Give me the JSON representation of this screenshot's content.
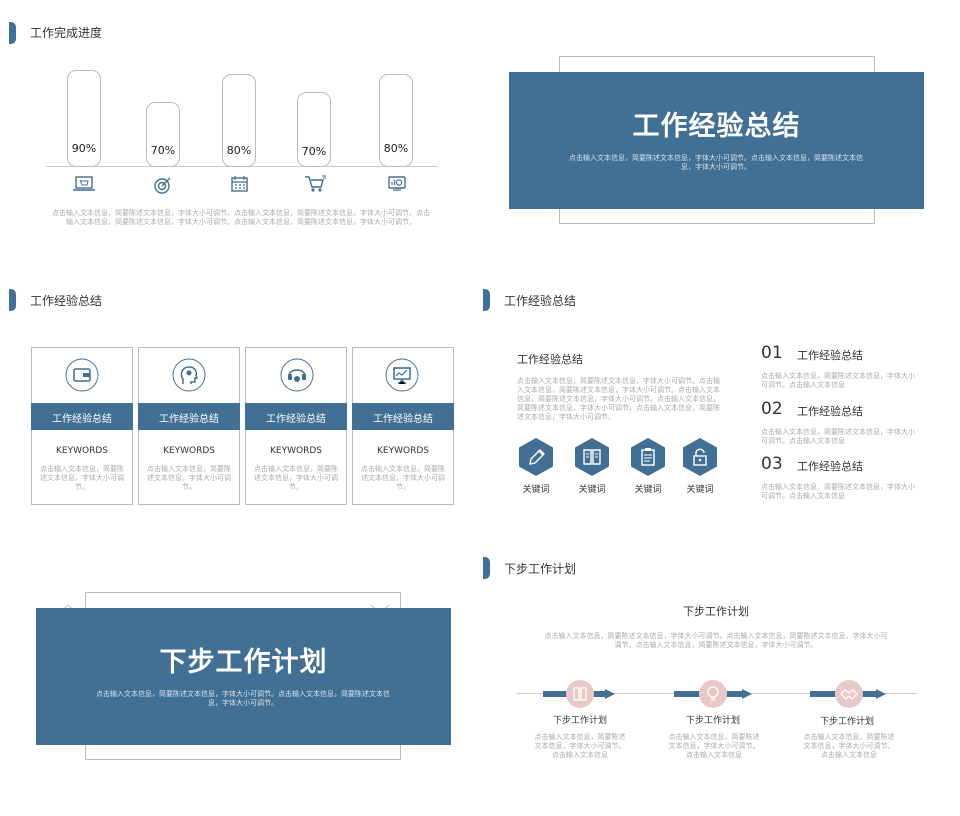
{
  "slide1": {
    "title": "工作完成进度",
    "bars": [
      {
        "label": "90%",
        "icon": "laptop-cart-icon"
      },
      {
        "label": "70%",
        "icon": "target-icon"
      },
      {
        "label": "80%",
        "icon": "calendar-icon"
      },
      {
        "label": "70%",
        "icon": "shopping-cart-icon"
      },
      {
        "label": "80%",
        "icon": "monitor-chart-icon"
      }
    ],
    "desc": "点击输入文本信息，简要陈述文本信息，字体大小可调节。点击输入文本信息，简要陈述文本信息，字体大小可调节。点击输入文本信息，简要陈述文本信息，字体大小可调节。点击输入文本信息，简要陈述文本信息，字体大小可调节。"
  },
  "slide2": {
    "title": "工作经验总结",
    "desc": "点击输入文本信息，简要陈述文本信息，字体大小可调节。点击输入文本信息，简要陈述文本信息，字体大小可调节。"
  },
  "slide3": {
    "title": "工作经验总结",
    "cards": [
      {
        "icon": "wallet-icon",
        "heading": "工作经验总结",
        "keyword": "KEYWORDS",
        "desc": "点击输入文本信息，简要陈述文本信息，字体大小可调节。"
      },
      {
        "icon": "head-idea-icon",
        "heading": "工作经验总结",
        "keyword": "KEYWORDS",
        "desc": "点击输入文本信息，简要陈述文本信息，字体大小可调节。"
      },
      {
        "icon": "support-headset-icon",
        "heading": "工作经验总结",
        "keyword": "KEYWORDS",
        "desc": "点击输入文本信息，简要陈述文本信息，字体大小可调节。"
      },
      {
        "icon": "presentation-board-icon",
        "heading": "工作经验总结",
        "keyword": "KEYWORDS",
        "desc": "点击输入文本信息，简要陈述文本信息，字体大小可调节。"
      }
    ]
  },
  "slide4": {
    "title": "工作经验总结",
    "sub_title": "工作经验总结",
    "sub_desc": "点击输入文本信息，简要陈述文本信息，字体大小可调节。点击输入文本信息，简要陈述文本信息，字体大小可调节。点击输入文本信息，简要陈述文本信息，字体大小可调节。点击输入文本信息，简要陈述文本信息，字体大小可调节。点击输入文本信息，简要陈述文本信息，字体大小可调节。",
    "hexes": [
      {
        "icon": "pencil-icon",
        "label": "关键词"
      },
      {
        "icon": "book-icon",
        "label": "关键词"
      },
      {
        "icon": "clipboard-icon",
        "label": "关键词"
      },
      {
        "icon": "lock-icon",
        "label": "关键词"
      }
    ],
    "items": [
      {
        "num": "01",
        "heading": "工作经验总结",
        "desc": "点击输入文本信息，简要陈述文本信息，字体大小可调节。点击输入文本信息"
      },
      {
        "num": "02",
        "heading": "工作经验总结",
        "desc": "点击输入文本信息，简要陈述文本信息，字体大小可调节。点击输入文本信息"
      },
      {
        "num": "03",
        "heading": "工作经验总结",
        "desc": "点击输入文本信息，简要陈述文本信息，字体大小可调节。点击输入文本信息"
      }
    ]
  },
  "slide5": {
    "title": "下步工作计划",
    "desc": "点击输入文本信息，简要陈述文本信息，字体大小可调节。点击输入文本信息，简要陈述文本信息，字体大小可调节。"
  },
  "slide6": {
    "title": "下步工作计划",
    "heading": "下步工作计划",
    "desc": "点击输入文本信息，简要陈述文本信息，字体大小可调节。点击输入文本信息，简要陈述文本信息，字体大小可调节。点击输入文本信息，简要陈述文本信息，字体大小可调节。",
    "steps": [
      {
        "icon": "book-icon",
        "label": "下步工作计划",
        "desc": "点击输入文本信息，简要陈述文本信息，字体大小可调节。点击输入文本信息"
      },
      {
        "icon": "lightbulb-icon",
        "label": "下步工作计划",
        "desc": "点击输入文本信息，简要陈述文本信息，字体大小可调节。点击输入文本信息"
      },
      {
        "icon": "handshake-icon",
        "label": "下步工作计划",
        "desc": "点击输入文本信息，简要陈述文本信息，字体大小可调节。点击输入文本信息"
      }
    ]
  },
  "colors": {
    "accent": "#426f94",
    "pink": "#e8c8c8"
  }
}
